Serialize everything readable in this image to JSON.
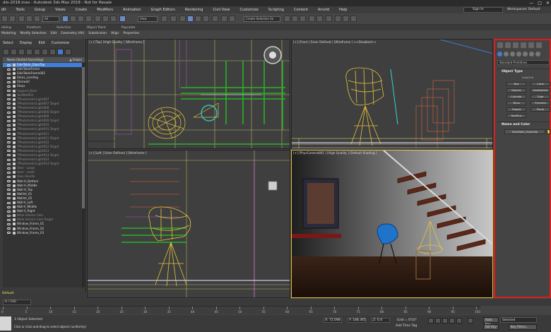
{
  "titlebar": {
    "title": "dio-2018.max - Autodesk 3ds Max 2018 - Not for Resale",
    "min": "—",
    "max": "□",
    "close": "✕"
  },
  "menu": [
    "dit",
    "Tools",
    "Group",
    "Views",
    "Create",
    "Modifiers",
    "Animation",
    "Graph Editors",
    "Rendering",
    "Civil View",
    "Customize",
    "Scripting",
    "Content",
    "Arnold",
    "Help"
  ],
  "signin": "Sign In",
  "workspaces": "Workspaces: Default",
  "toolbar": {
    "view_dropdown": "View",
    "selection_set": "Create Selection Se"
  },
  "ribbon_tabs": [
    "deling",
    "Freeform",
    "Selection",
    "Object Paint",
    "Populate"
  ],
  "ribbon_row2": [
    "Modeling",
    "Modify Selection",
    "Edit",
    "Geometry (All)",
    "Subdivision",
    "Align",
    "Properties"
  ],
  "scene_explorer": {
    "tabs": [
      "Select",
      "Display",
      "Edit",
      "Customize"
    ],
    "header": "Name (Sorted Ascending)",
    "frozen": "▲ Frozen",
    "items": [
      {
        "name": "SideTable_GlassTop",
        "state": "selected"
      },
      {
        "name": "SideTableFrame",
        "state": "normal"
      },
      {
        "name": "SideTableFrame002",
        "state": "normal"
      },
      {
        "name": "Stairs_Landing",
        "state": "normal"
      },
      {
        "name": "Stairwall",
        "state": "normal"
      },
      {
        "name": "Steps",
        "state": "normal"
      },
      {
        "name": "Support_Base",
        "state": "dim"
      },
      {
        "name": "TestMat001",
        "state": "dim"
      },
      {
        "name": "TPhotometricLight007",
        "state": "dim"
      },
      {
        "name": "TPhotometricLight007.Target",
        "state": "dim"
      },
      {
        "name": "TPhotometricLight008",
        "state": "dim"
      },
      {
        "name": "TPhotometricLight008.Target",
        "state": "dim"
      },
      {
        "name": "TPhotometricLight009",
        "state": "dim"
      },
      {
        "name": "TPhotometricLight009.Target",
        "state": "dim"
      },
      {
        "name": "TPhotometricLight010",
        "state": "dim"
      },
      {
        "name": "TPhotometricLight010.Target",
        "state": "dim"
      },
      {
        "name": "TPhotometricLight011",
        "state": "dim"
      },
      {
        "name": "TPhotometricLight011.Target",
        "state": "dim"
      },
      {
        "name": "TPhotometricLight012",
        "state": "dim"
      },
      {
        "name": "TPhotometricLight012.Target",
        "state": "dim"
      },
      {
        "name": "TPhotometricLight013",
        "state": "dim"
      },
      {
        "name": "TPhotometricLight013.Target",
        "state": "dim"
      },
      {
        "name": "TPhotometricLight014",
        "state": "dim"
      },
      {
        "name": "TPhotometricLight014.Target",
        "state": "dim"
      },
      {
        "name": "Vase - Large",
        "state": "dim"
      },
      {
        "name": "Vase - small",
        "state": "dim"
      },
      {
        "name": "Vase Handle",
        "state": "dim"
      },
      {
        "name": "Wall-H_Bottom",
        "state": "normal"
      },
      {
        "name": "Wall-H_Middle",
        "state": "normal"
      },
      {
        "name": "Wall-H_Top",
        "state": "normal"
      },
      {
        "name": "WallInt_01",
        "state": "normal"
      },
      {
        "name": "WallInt_02",
        "state": "normal"
      },
      {
        "name": "Wall-V_Left",
        "state": "normal"
      },
      {
        "name": "Wall-V_Middle",
        "state": "normal"
      },
      {
        "name": "Wall-V_Right",
        "state": "normal"
      },
      {
        "name": "Wide Interior Cam",
        "state": "dim"
      },
      {
        "name": "Wide Interior Cam.Target",
        "state": "dim"
      },
      {
        "name": "Window_Frame_01",
        "state": "normal"
      },
      {
        "name": "Window_Frame_02",
        "state": "normal"
      },
      {
        "name": "Window_Frame_03",
        "state": "normal"
      }
    ]
  },
  "layer": "Default",
  "viewports": {
    "top": "[+] [Top] [High Quality ] [Wireframe ]",
    "front": "[+] [Front ] [User Defined ] [Wireframe ] <<Disabled>>",
    "left": "[+] [Left ] [User Defined ] [Wireframe ]",
    "camera": "[+] [PhysCamera001 ] [High Quality ] [Default Shading ]"
  },
  "command_panel": {
    "primitive_type": "Standard Primitives",
    "object_type_title": "Object Type",
    "autogrid": "AutoGrid",
    "buttons": [
      "Box",
      "Cone",
      "Sphere",
      "GeoSphere",
      "Cylinder",
      "Tube",
      "Torus",
      "Pyramid",
      "Teapot",
      "Plane",
      "TextPlus"
    ],
    "name_color_title": "Name and Color",
    "object_name": "SideTable_GlassTop"
  },
  "timeline": {
    "frame": "0 / 100",
    "ticks": [
      "0",
      "5",
      "10",
      "15",
      "20",
      "25",
      "30",
      "35",
      "40",
      "45",
      "50",
      "55",
      "60",
      "65",
      "70",
      "75",
      "80",
      "85",
      "90",
      "95",
      "100"
    ]
  },
  "status": {
    "objects": "1 Object Selected",
    "prompt": "Click or click-and-drag to select objects (uniformly)",
    "x": "X: 72.098",
    "y": "Y: 188.365",
    "z": "Z: 0.0",
    "grid": "Grid = 0'10\"",
    "add_time_tag": "Add Time Tag",
    "autokey": "Auto Key",
    "setkey": "Set Key",
    "selected": "Selected",
    "keyfilters": "Key Filters..."
  }
}
